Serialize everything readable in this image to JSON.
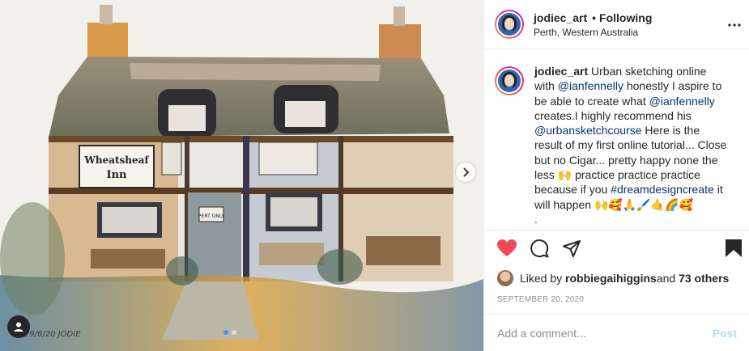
{
  "post": {
    "username": "jodiec_art",
    "separator": "•",
    "follow_state": "Following",
    "location": "Perth, Western Australia",
    "more_icon": "more-horizontal-icon"
  },
  "media": {
    "artwork_sign_text": "Wheatsheaf Inn",
    "door_sign_text": "PERT ONLY",
    "signature_text": "29/6/20 JODIE",
    "carousel_dots": 2,
    "active_dot": 1,
    "next_icon": "chevron-right-icon",
    "tag_icon": "user-tag-icon"
  },
  "caption": {
    "username": "jodiec_art",
    "t1": " Urban sketching online with ",
    "m1": "@ianfennelly",
    "t2": " honestly I aspire to be able to create what ",
    "m2": "@ianfennelly",
    "t3": " creates.I highly recommend his ",
    "m3": "@urbansketchcourse",
    "t4": " Here is the result of my first online tutorial... Close but no Cigar... pretty happy none the less 🙌 practice practice practice because if you ",
    "h1": "#dreamdesigncreate",
    "t5": " it will happen 🙌🥰🙏🖌️🤙🌈🥰",
    "t6": "."
  },
  "actions": {
    "like_icon": "heart-filled-icon",
    "comment_icon": "comment-icon",
    "share_icon": "share-icon",
    "save_icon": "bookmark-filled-icon",
    "like_color": "#ed4956"
  },
  "likes": {
    "prefix": "Liked by ",
    "user": "robbiegaihiggins",
    "middle": " and ",
    "others": "73 others"
  },
  "date": "SEPTEMBER 20, 2020",
  "comment_box": {
    "placeholder": "Add a comment...",
    "post_label": "Post"
  }
}
